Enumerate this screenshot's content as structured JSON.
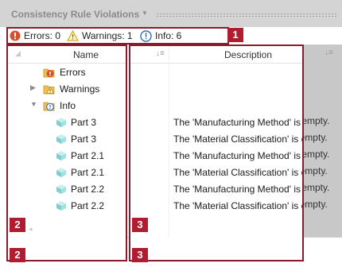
{
  "panel": {
    "title": "Consistency Rule Violations"
  },
  "status": {
    "errors": "Errors: 0",
    "warnings": "Warnings: 1",
    "info": "Info: 6"
  },
  "tree": {
    "header": "Name",
    "items": [
      {
        "label": "Errors",
        "icon": "error-folder-icon"
      },
      {
        "label": "Warnings",
        "icon": "warning-folder-icon"
      },
      {
        "label": "Info",
        "icon": "info-folder-icon"
      },
      {
        "label": "Part 3",
        "icon": "part-cube-icon"
      },
      {
        "label": "Part 3",
        "icon": "part-cube-icon"
      },
      {
        "label": "Part 2.1",
        "icon": "part-cube-icon"
      },
      {
        "label": "Part 2.1",
        "icon": "part-cube-icon"
      },
      {
        "label": "Part 2.2",
        "icon": "part-cube-icon"
      },
      {
        "label": "Part 2.2",
        "icon": "part-cube-icon"
      }
    ]
  },
  "description": {
    "header": "Description",
    "rows": [
      "The 'Manufacturing Method' is empty.",
      "The 'Material Classification' is empty.",
      "The 'Manufacturing Method' is empty.",
      "The 'Material Classification' is empty.",
      "The 'Manufacturing Method' is empty.",
      "The 'Material Classification' is empty."
    ]
  },
  "callouts": {
    "c1": "1",
    "c2a": "2",
    "c2b": "2",
    "c3a": "3",
    "c3b": "3"
  },
  "colors": {
    "accent_border": "#8b1a2e",
    "callout": "#b01c30",
    "error": "#d9502f",
    "info": "#2f6fc4",
    "warning": "#e0a100"
  }
}
